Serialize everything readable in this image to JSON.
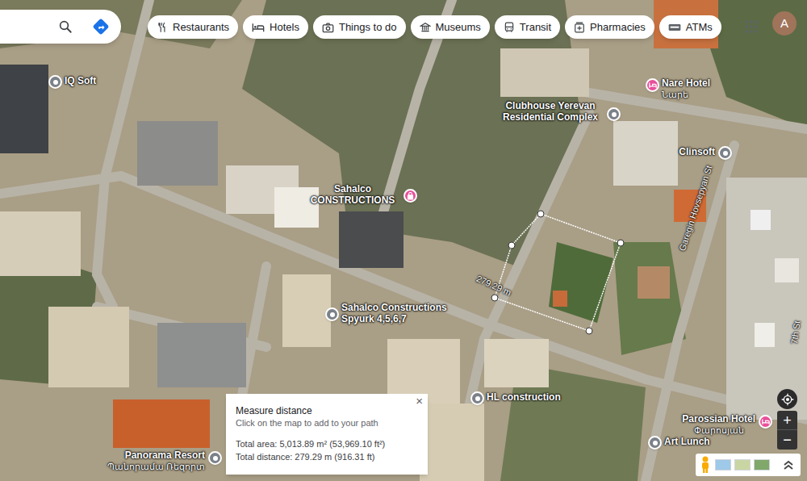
{
  "top_bar": {
    "categories": [
      {
        "label": "Restaurants",
        "kind": "restaurants"
      },
      {
        "label": "Hotels",
        "kind": "hotels"
      },
      {
        "label": "Things to do",
        "kind": "attractions"
      },
      {
        "label": "Museums",
        "kind": "museums"
      },
      {
        "label": "Transit",
        "kind": "transit"
      },
      {
        "label": "Pharmacies",
        "kind": "pharmacies"
      },
      {
        "label": "ATMs",
        "kind": "atms"
      }
    ],
    "account_initial": "A"
  },
  "places": [
    {
      "name": "IQ Soft",
      "kind": "poi"
    },
    {
      "name": "Nare Hotel",
      "subtitle": "Նարե",
      "kind": "hotel"
    },
    {
      "name": "Clubhouse Yerevan Residential Complex",
      "kind": "poi"
    },
    {
      "name": "Clinsoft",
      "kind": "poi"
    },
    {
      "name": "Sahalco CONSTRUCTIONS",
      "kind": "shop"
    },
    {
      "name": "Sahalco Constructions Spyurk 4,5,6,7",
      "kind": "poi"
    },
    {
      "name": "HL construction",
      "kind": "poi"
    },
    {
      "name": "Art Lunch",
      "kind": "poi"
    },
    {
      "name": "Panorama Resort",
      "subtitle": "Պանորամա Ռեզորտ",
      "kind": "poi"
    },
    {
      "name": "Parossian Hotel",
      "subtitle": "Փարոսյան",
      "kind": "hotel"
    }
  ],
  "roads": [
    {
      "name": "Garegin Hovsepyan St"
    },
    {
      "name": "7th St"
    }
  ],
  "measurement": {
    "segment_label": "279.29 m",
    "panel": {
      "title": "Measure distance",
      "hint": "Click on the map to add to your path",
      "area": "Total area: 5,013.89 m² (53,969.10 ft²)",
      "distance": "Total distance: 279.29 m (916.31 ft)",
      "close": "×"
    }
  },
  "map_controls": {
    "zoom_in": "+",
    "zoom_out": "−"
  }
}
